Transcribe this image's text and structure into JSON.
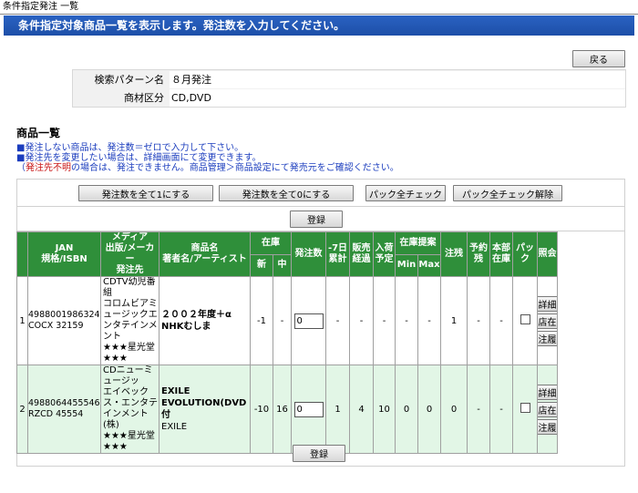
{
  "window_title": "条件指定発注 一覧",
  "banner": "条件指定対象商品一覧を表示します。発注数を入力してください。",
  "back_label": "戻る",
  "search": {
    "pattern_label": "検索パターン名",
    "pattern_value": "８月発注",
    "category_label": "商材区分",
    "category_value": "CD,DVD"
  },
  "section_title": "商品一覧",
  "notes": {
    "line1": "■発注しない商品は、発注数＝ゼロで入力して下さい。",
    "line2": "■発注先を変更したい場合は、詳細画面にて変更できます。",
    "line3_prefix": "（",
    "line3_red": "発注先不明",
    "line3_rest": "の場合は、発注できません。商品管理＞商品設定にて発売元をご確認ください。"
  },
  "toolbar": {
    "set_all_one": "発注数を全て1にする",
    "set_all_zero": "発注数を全て0にする",
    "pack_check_all": "パック全チェック",
    "pack_uncheck_all": "パック全チェック解除"
  },
  "register_label": "登録",
  "columns": {
    "jan": "JAN",
    "spec": "規格/ISBN",
    "media": "メディア",
    "publisher": "出版/メーカー",
    "supplier": "発注先",
    "product_name": "商品名",
    "author": "著者名/アーティスト",
    "stock": "在庫",
    "stock_new": "新",
    "stock_used": "中",
    "order_qty": "発注数",
    "past7": "-7日",
    "past7b": "累計",
    "sales": "販売",
    "sales_b": "経過",
    "incoming": "入荷",
    "incoming_b": "予定",
    "stock_prop": "在庫提案",
    "min": "Min",
    "max": "Max",
    "order_rem": "注残",
    "reserve": "予約",
    "reserve_b": "残",
    "hq": "本部",
    "hq_b": "在庫",
    "pack": "パック",
    "ref": "照会"
  },
  "rows": [
    {
      "no": "1",
      "jan": "4988001986324",
      "spec": "COCX 32159",
      "media": "CDTV幼児番組",
      "maker": "コロムビアミュージックエンタテインメント",
      "supplier": "★★★星光堂★★★",
      "title": "２００２年度＋α",
      "artist": "NHKむしま",
      "stock_new": "-1",
      "stock_used": "-",
      "qty": "0",
      "past7": "-",
      "sales": "-",
      "incoming": "-",
      "min": "-",
      "max": "-",
      "order_rem": "1",
      "reserve": "-",
      "hq": "-"
    },
    {
      "no": "2",
      "jan": "4988064455546",
      "spec": "RZCD 45554",
      "media": "CDニューミュージッ",
      "maker": "エイベックス・エンタテインメント(株)",
      "supplier": "★★★星光堂★★★",
      "title": "EXILE EVOLUTION(DVD付",
      "artist": "EXILE",
      "stock_new": "-10",
      "stock_used": "16",
      "qty": "0",
      "past7": "1",
      "sales": "4",
      "incoming": "10",
      "min": "0",
      "max": "0",
      "order_rem": "0",
      "reserve": "-",
      "hq": "-"
    }
  ],
  "ref_buttons": {
    "detail": "詳細",
    "other_stock": "他店在庫",
    "order_history": "発注履歴"
  }
}
